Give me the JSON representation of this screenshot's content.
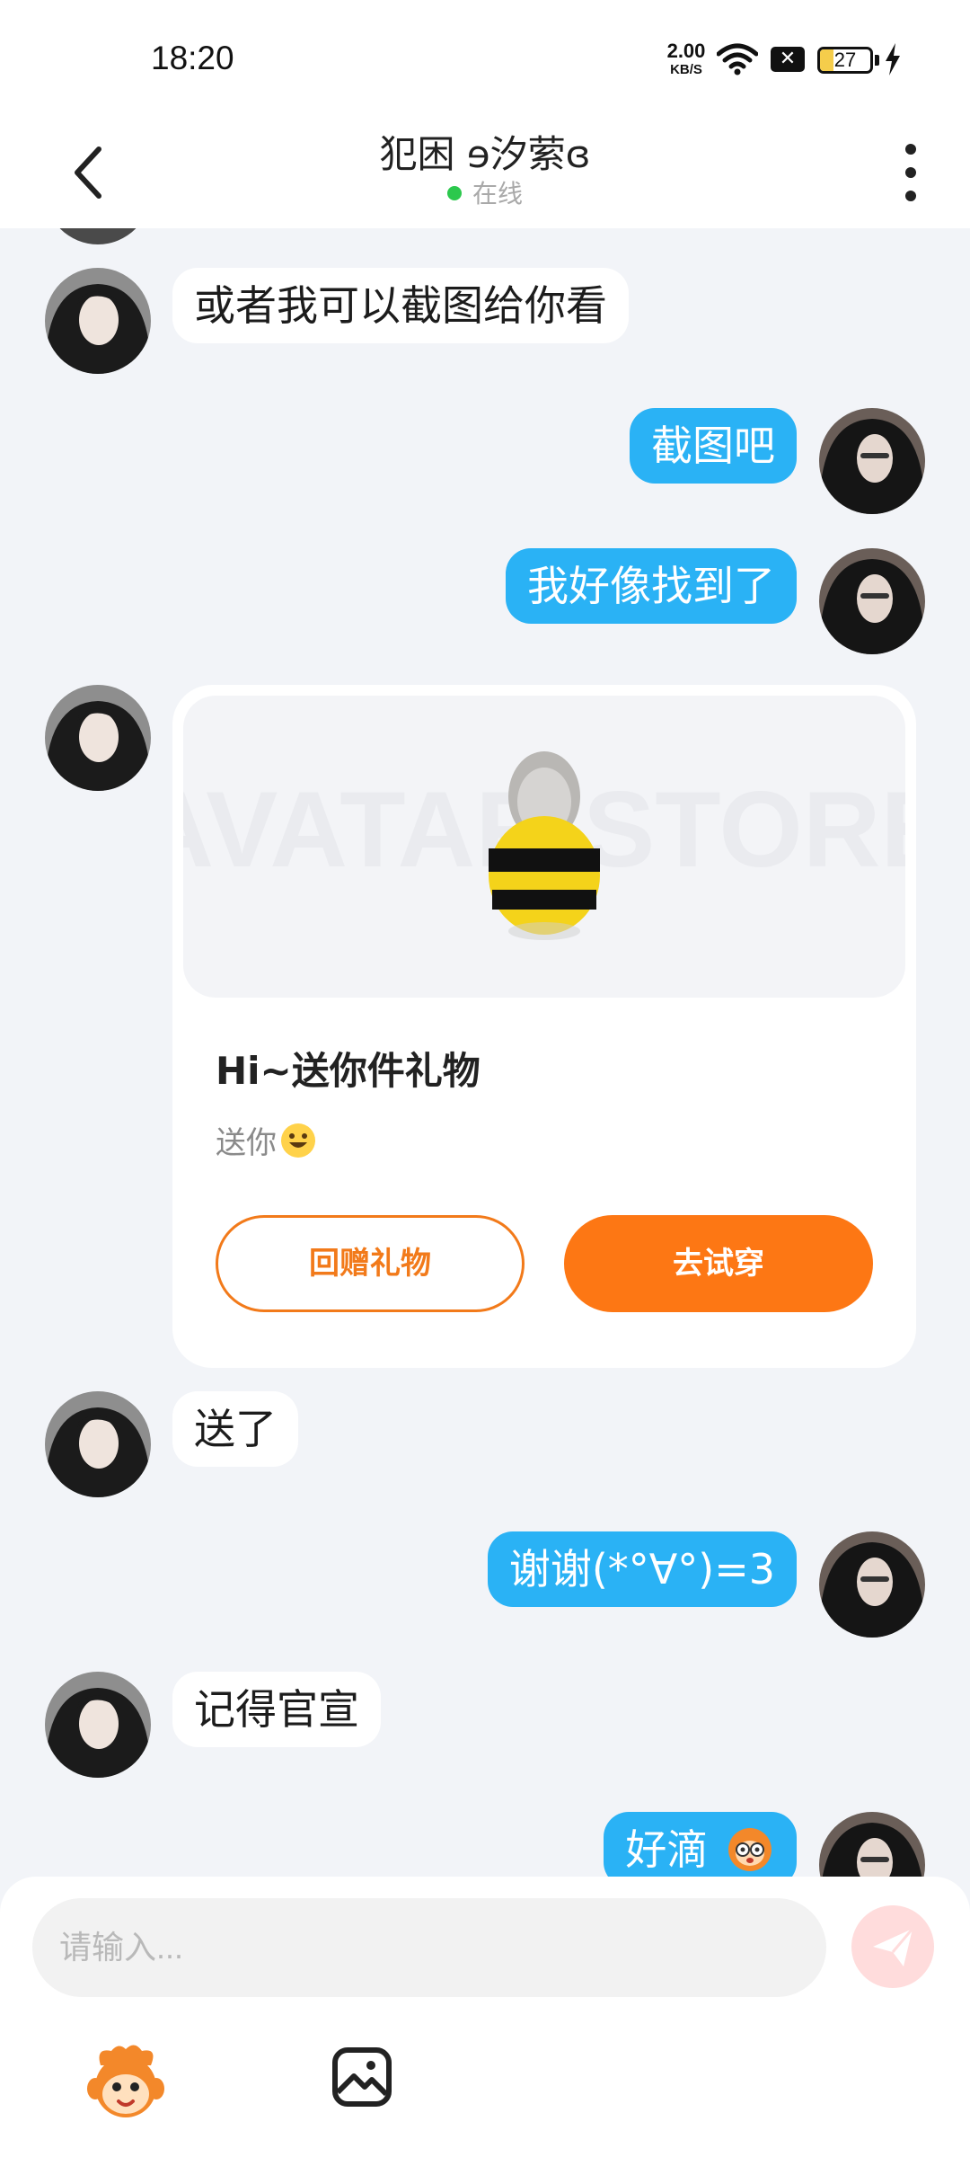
{
  "status_bar": {
    "time": "18:20",
    "net_speed_value": "2.00",
    "net_speed_unit": "KB/S",
    "battery_level": "27",
    "icons": [
      "wifi-icon",
      "no-sim-icon",
      "battery-icon",
      "charging-icon"
    ]
  },
  "header": {
    "contact_name": "犯困 ɘ汐萦ɞ",
    "status_text": "在线",
    "icons": [
      "back-icon",
      "more-icon"
    ]
  },
  "messages": [
    {
      "from": "them",
      "text": "或者我可以截图给你看"
    },
    {
      "from": "me",
      "text": "截图吧"
    },
    {
      "from": "me",
      "text": "我好像找到了"
    },
    {
      "from": "them",
      "type": "gift",
      "title": "Hi~送你件礼物",
      "subtitle": "送你",
      "image_watermark": "AVATAR STORE",
      "return_button": "回赠礼物",
      "try_button": "去试穿"
    },
    {
      "from": "them",
      "text": "送了"
    },
    {
      "from": "me",
      "text": "谢谢(*°∀°)=3"
    },
    {
      "from": "them",
      "text": "记得官宣"
    },
    {
      "from": "me",
      "text": "好滴"
    }
  ],
  "composer": {
    "placeholder": "请输入...",
    "icons": [
      "send-icon",
      "sticker-icon",
      "image-icon"
    ]
  },
  "colors": {
    "outgoing_bubble": "#2ab2f5",
    "incoming_bubble": "#ffffff",
    "chat_background": "#f2f4f8",
    "gift_accent": "#fd7714",
    "online_dot": "#2cc84d",
    "send_button": "#ffdcdc"
  }
}
